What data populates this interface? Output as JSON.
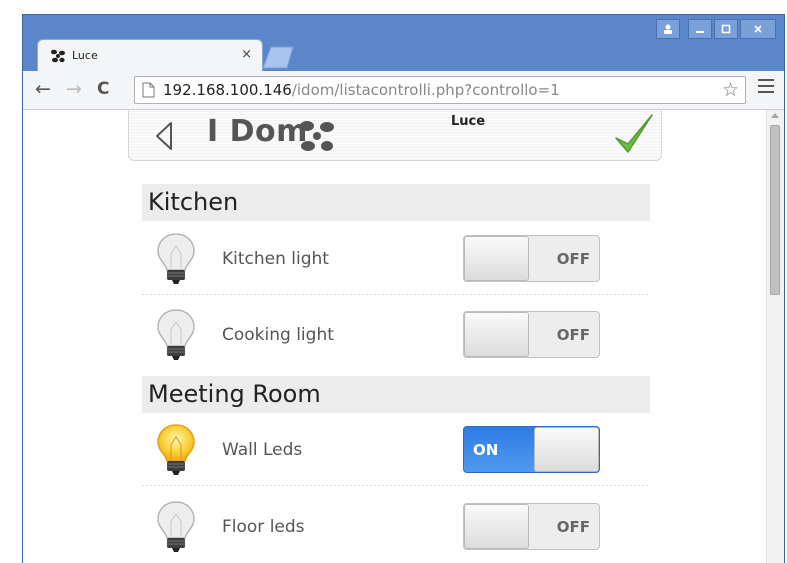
{
  "browser": {
    "tab_title": "Luce",
    "tab_close": "×",
    "url_host": "192.168.100.146",
    "url_path": "/idom/listacontrolli.php?controllo=1"
  },
  "app": {
    "logo_text": "I Dom",
    "title": "Luce"
  },
  "sections": [
    {
      "title": "Kitchen",
      "lights": [
        {
          "name": "Kitchen light",
          "state": "OFF"
        },
        {
          "name": "Cooking light",
          "state": "OFF"
        }
      ]
    },
    {
      "title": "Meeting Room",
      "lights": [
        {
          "name": "Wall Leds",
          "state": "ON"
        },
        {
          "name": "Floor leds",
          "state": "OFF"
        }
      ]
    }
  ],
  "colors": {
    "toggle_on": "#3585e8",
    "bulb_on": "#f9d33a",
    "check": "#6fbf3f"
  }
}
